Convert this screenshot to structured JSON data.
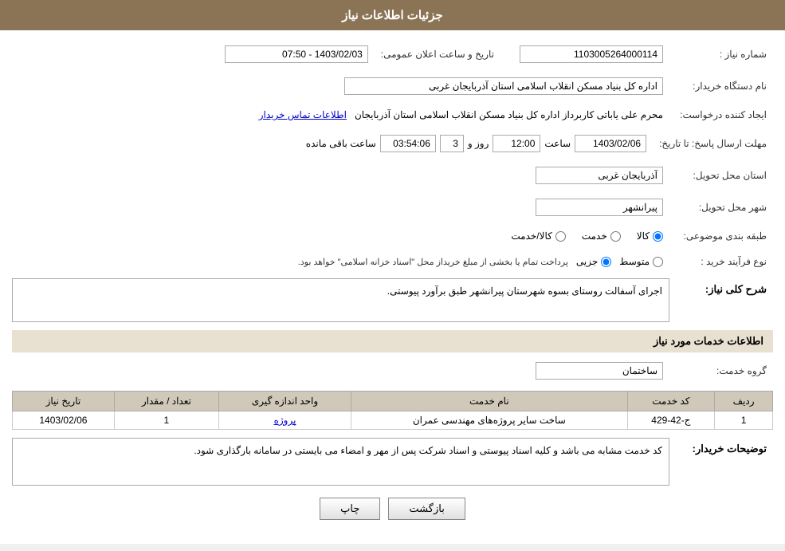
{
  "header": {
    "title": "جزئیات اطلاعات نیاز"
  },
  "fields": {
    "need_number_label": "شماره نیاز :",
    "need_number_value": "1103005264000114",
    "announcement_date_label": "تاریخ و ساعت اعلان عمومی:",
    "announcement_date_value": "1403/02/03 - 07:50",
    "buyer_org_label": "نام دستگاه خریدار:",
    "buyer_org_value": "اداره کل بنیاد مسکن انقلاب اسلامی استان آذربایجان غربی",
    "creator_label": "ایجاد کننده درخواست:",
    "creator_value": "محرم علی یاباتی کاربرداز اداره کل بنیاد مسکن انقلاب اسلامی استان آذربایجان",
    "creator_link": "اطلاعات تماس خریدار",
    "response_deadline_label": "مهلت ارسال پاسخ: تا تاریخ:",
    "response_date": "1403/02/06",
    "response_time_label": "ساعت",
    "response_time": "12:00",
    "response_days_label": "روز و",
    "response_days": "3",
    "response_remaining_label": "ساعت باقی مانده",
    "response_remaining": "03:54:06",
    "province_label": "استان محل تحویل:",
    "province_value": "آذربایجان غربی",
    "city_label": "شهر محل تحویل:",
    "city_value": "پیرانشهر",
    "category_label": "طبقه بندی موضوعی:",
    "category_radio1": "کالا",
    "category_radio2": "خدمت",
    "category_radio3": "کالا/خدمت",
    "process_label": "نوع فرآیند خرید :",
    "process_radio1": "جزیی",
    "process_radio2": "متوسط",
    "process_note": "پرداخت تمام یا بخشی از مبلغ خریداز محل \"اسناد خزانه اسلامی\" خواهد بود.",
    "need_description_label": "شرح کلی نیاز:",
    "need_description_value": "اجرای آسفالت روستای بسوه شهرستان پیرانشهر طبق برآورد پیوستی.",
    "services_section_label": "اطلاعات خدمات مورد نیاز",
    "service_group_label": "گروه خدمت:",
    "service_group_value": "ساختمان",
    "table": {
      "headers": [
        "ردیف",
        "کد خدمت",
        "نام خدمت",
        "واحد اندازه گیری",
        "تعداد / مقدار",
        "تاریخ نیاز"
      ],
      "rows": [
        {
          "row": "1",
          "code": "ج-42-429",
          "name": "ساخت سایر پروژه‌های مهندسی عمران",
          "unit": "پروژه",
          "quantity": "1",
          "date": "1403/02/06"
        }
      ]
    },
    "buyer_notes_label": "توضیحات خریدار:",
    "buyer_notes_value": "کد خدمت مشابه می باشد و کلیه اسناد پیوستی و اسناد شرکت پس از مهر و امضاء می بایستی در سامانه بارگذاری شود."
  },
  "buttons": {
    "print": "چاپ",
    "back": "بازگشت"
  }
}
